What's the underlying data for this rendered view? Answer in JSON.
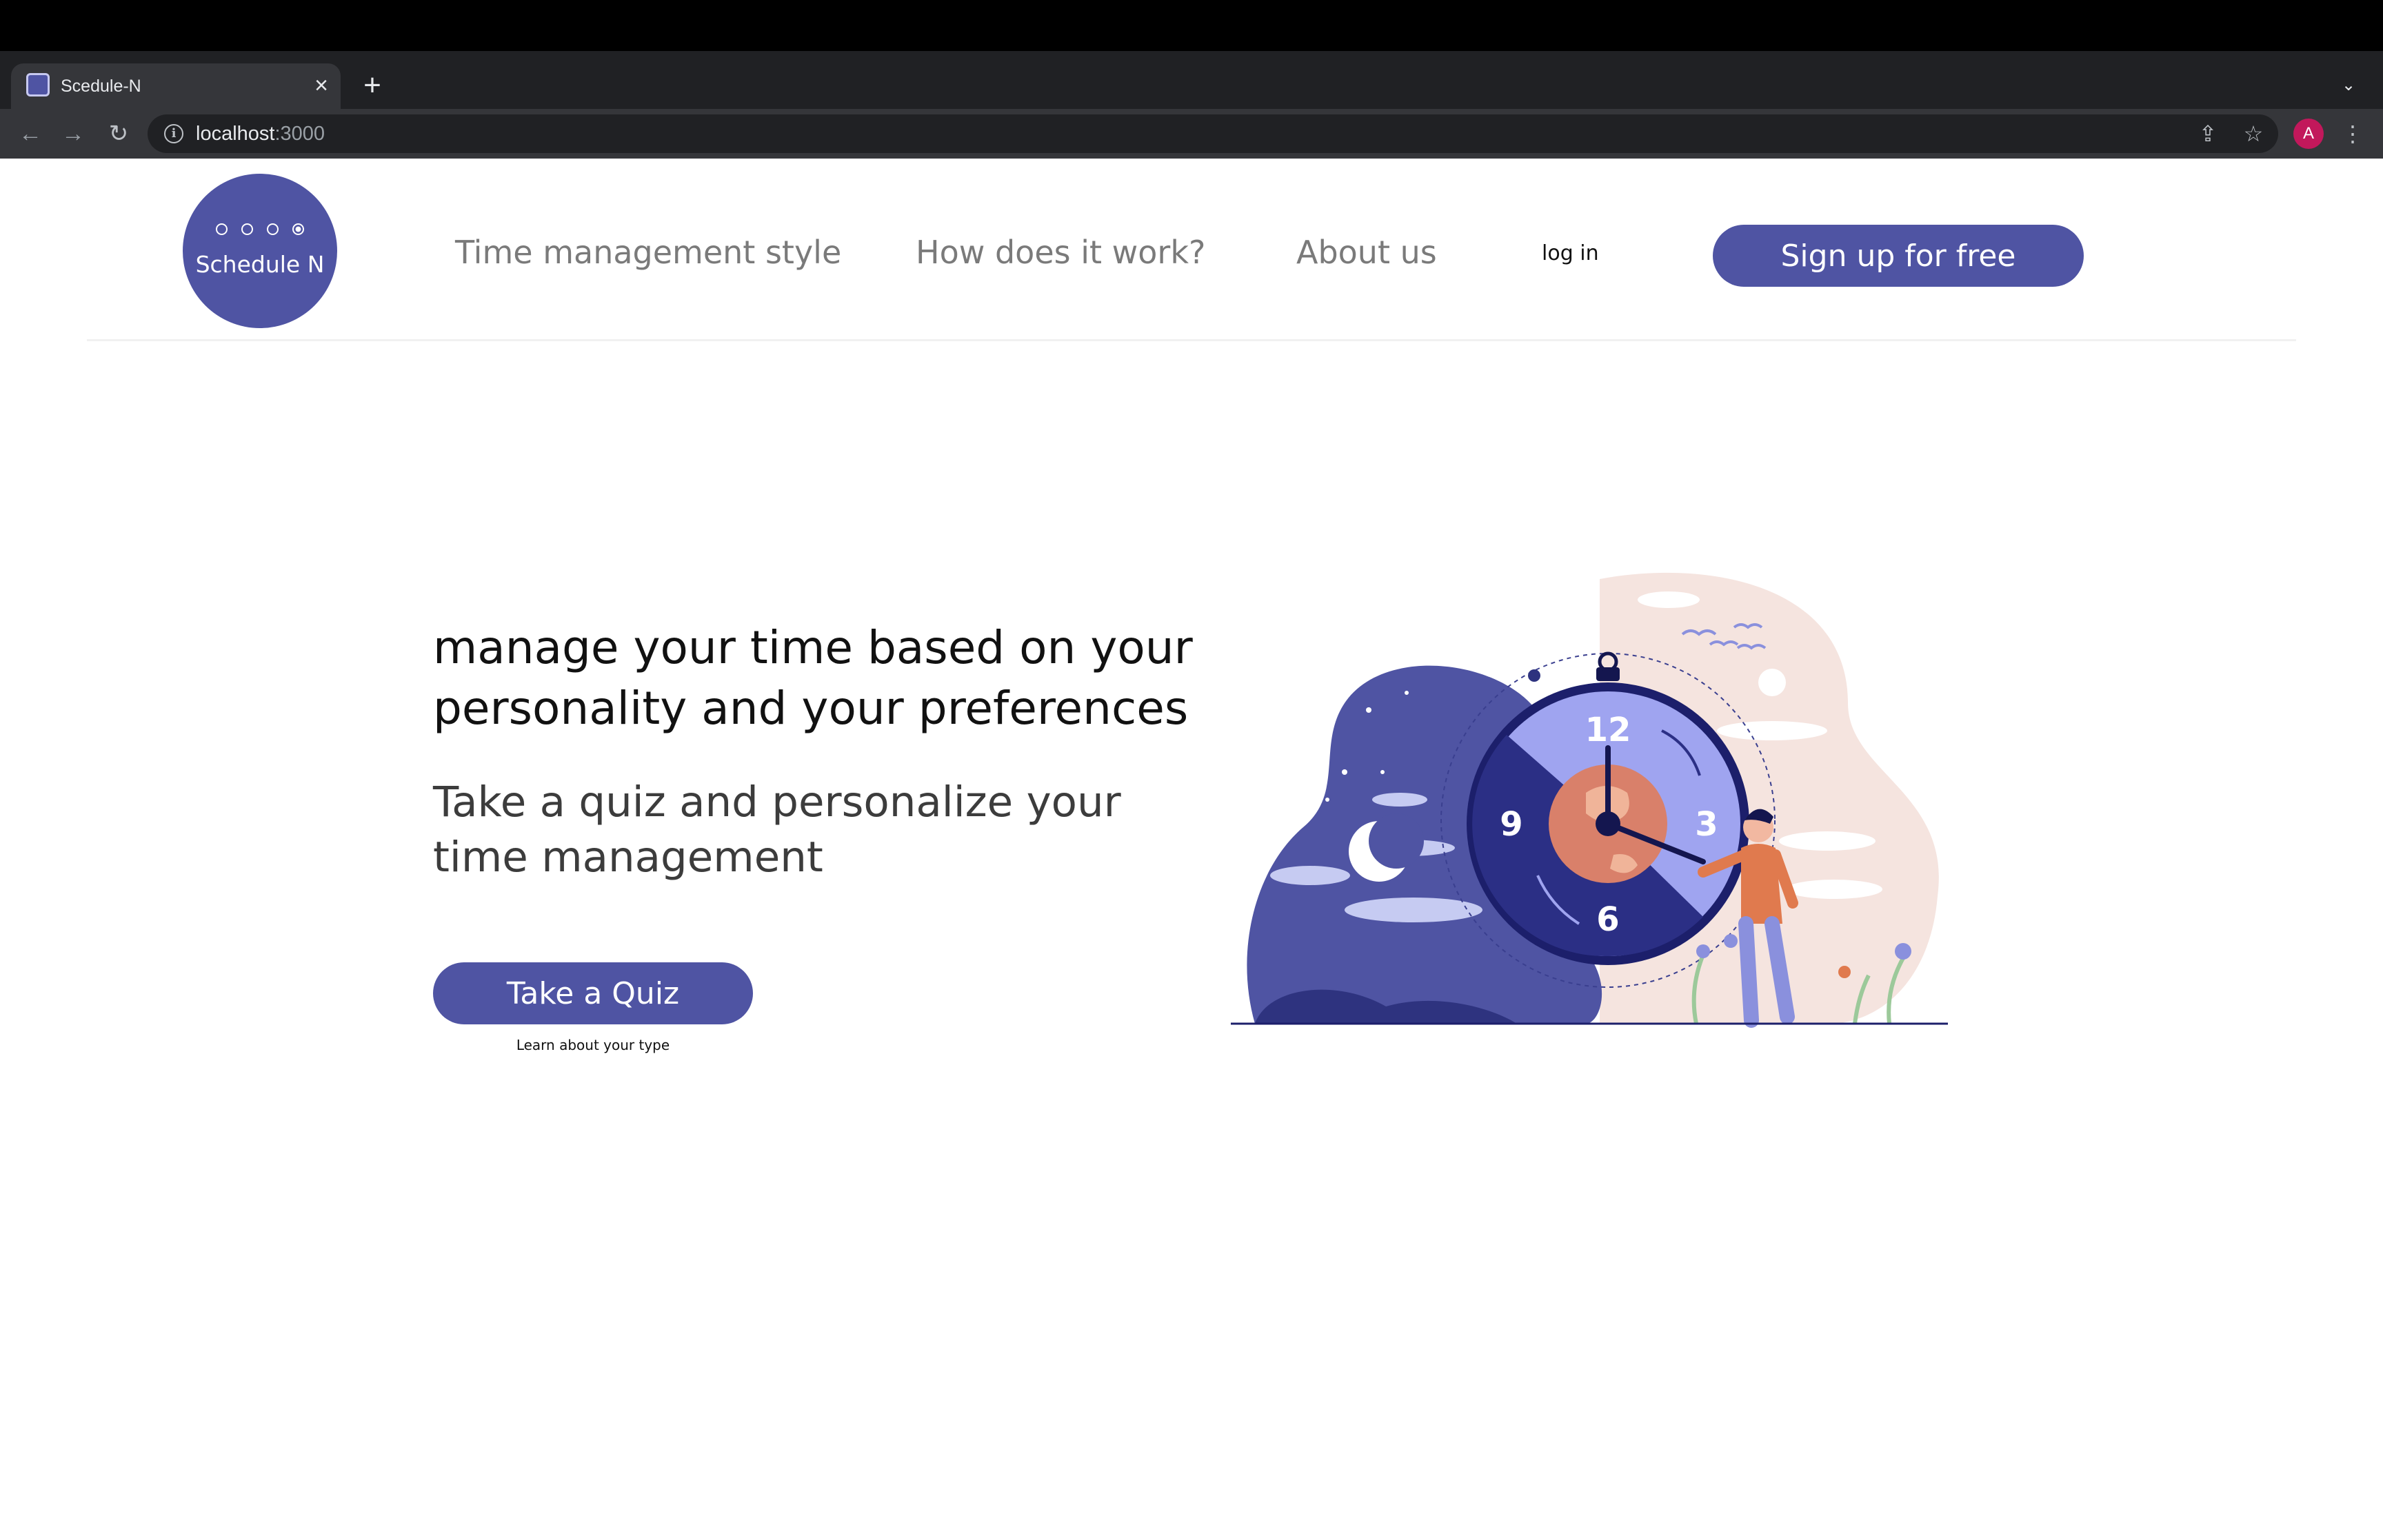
{
  "browser": {
    "tab_title": "Scedule-N",
    "url_host": "localhost",
    "url_port": ":3000",
    "avatar_letter": "A"
  },
  "header": {
    "logo_text": "Schedule N",
    "nav": [
      {
        "label": "Time management style"
      },
      {
        "label": "How does it work?"
      },
      {
        "label": "About us"
      }
    ],
    "login_label": "log in",
    "signup_label": "Sign up for free"
  },
  "hero": {
    "headline_line1": "manage your time based on your",
    "headline_line2": "personality and your preferences",
    "subhead_line1": "Take a quiz and personalize your",
    "subhead_line2": "time management",
    "cta_label": "Take a Quiz",
    "cta_caption": "Learn about your type"
  },
  "illustration": {
    "clock_numbers": [
      "12",
      "3",
      "6",
      "9"
    ]
  },
  "colors": {
    "brand": "#4f54a3",
    "brand_dark": "#1c1f6b",
    "blob_pink": "#f5e4df",
    "earth": "#d9806a"
  }
}
